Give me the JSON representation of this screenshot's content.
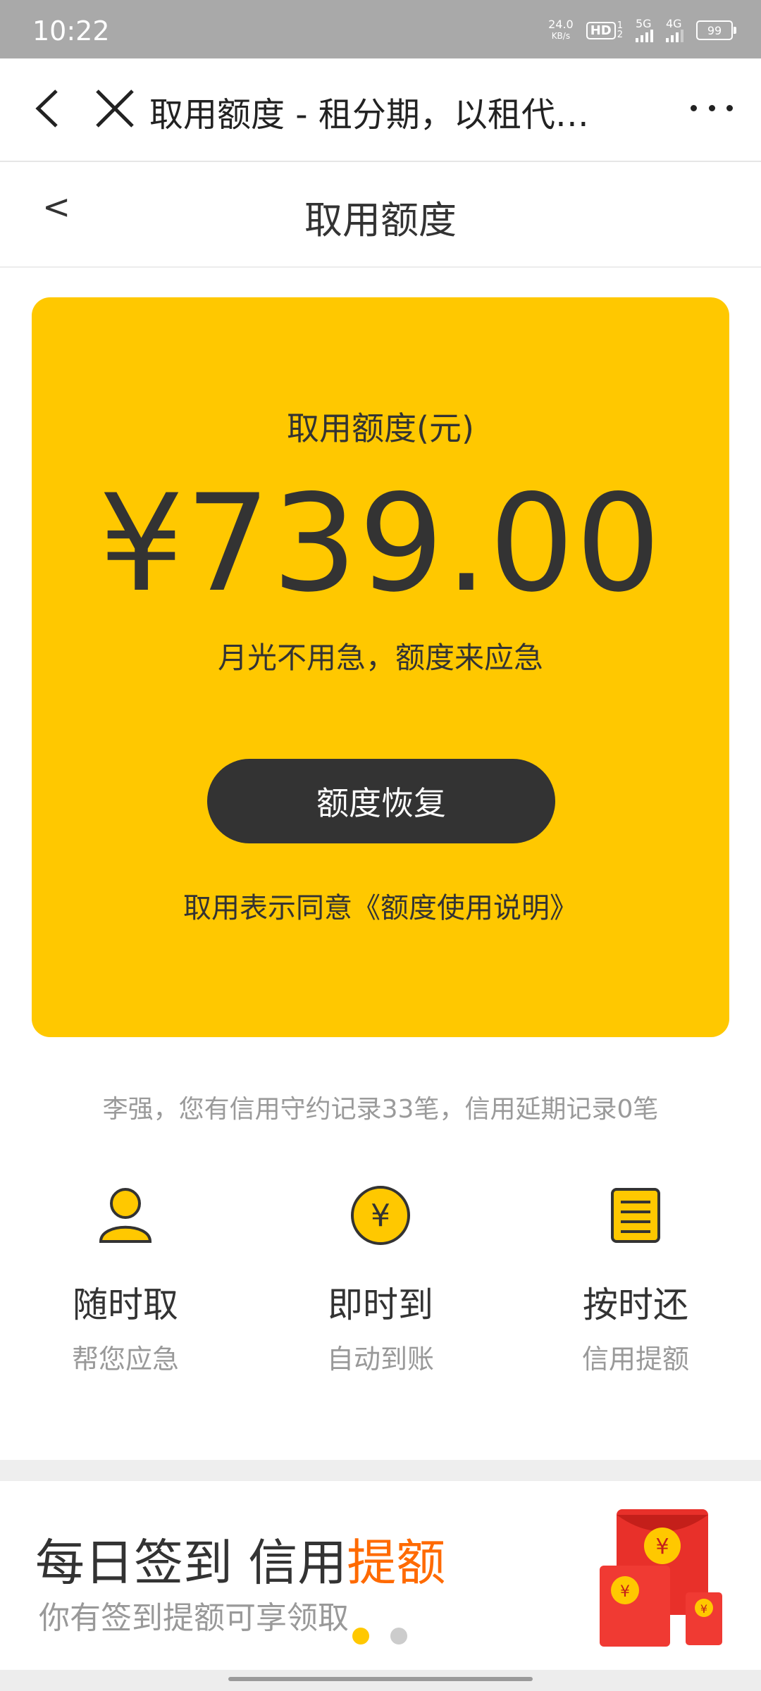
{
  "status_bar": {
    "time": "10:22",
    "speed_value": "24.0",
    "speed_unit": "KB/s",
    "hd": "HD",
    "sim1": "1",
    "sim2": "2",
    "net1": "5G",
    "net2": "4G",
    "battery": "99"
  },
  "browser": {
    "title": "取用额度 - 租分期，以租代…",
    "icons": [
      "back-arrow-icon",
      "close-icon",
      "more-icon"
    ]
  },
  "header": {
    "back_label": "<",
    "title": "取用额度"
  },
  "card": {
    "label": "取用额度(元)",
    "amount": "¥739.00",
    "slogan": "月光不用急，额度来应急",
    "button": "额度恢复",
    "agreement": "取用表示同意《额度使用说明》",
    "color": "#ffc800"
  },
  "record_text": "李强，您有信用守约记录33笔，信用延期记录0笔",
  "features": [
    {
      "icon": "person-icon",
      "title": "随时取",
      "subtitle": "帮您应急"
    },
    {
      "icon": "yuan-coin-icon",
      "title": "即时到",
      "subtitle": "自动到账"
    },
    {
      "icon": "document-icon",
      "title": "按时还",
      "subtitle": "信用提额"
    }
  ],
  "banner": {
    "title_part1": "每日签到 信用",
    "title_highlight": "提额",
    "subtitle": "你有签到提额可享领取",
    "highlight_color": "#ff6a00",
    "icon": "red-envelope-icon"
  },
  "carousel": {
    "active_index": 0,
    "count": 2
  }
}
